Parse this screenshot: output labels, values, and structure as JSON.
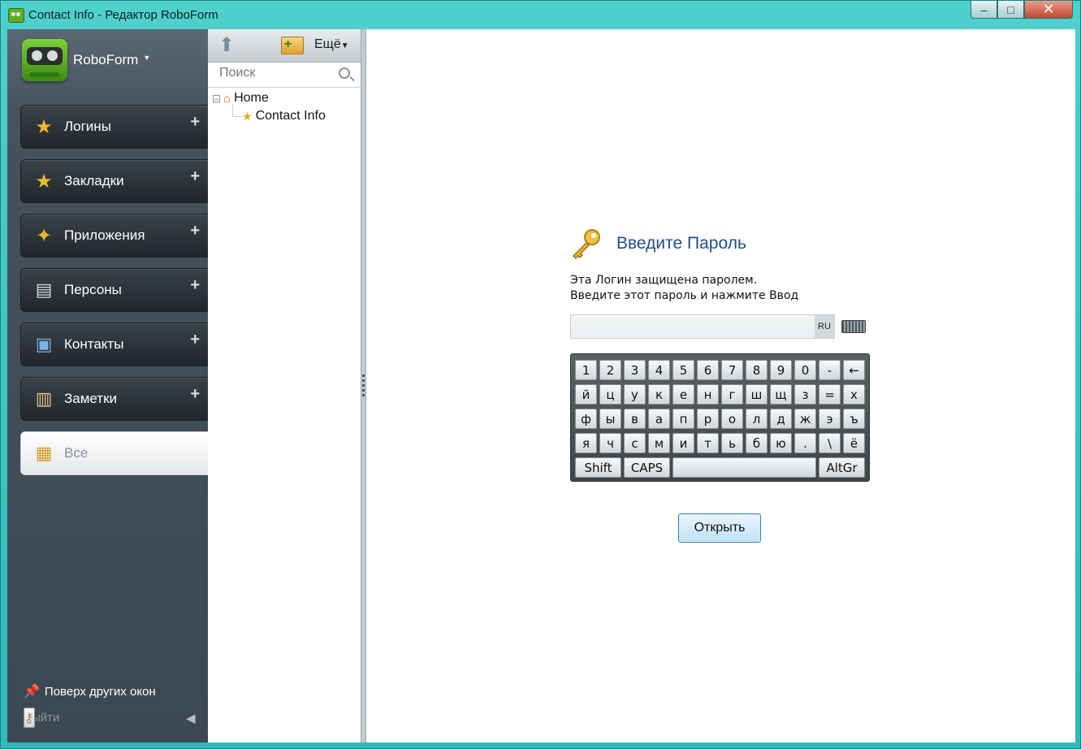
{
  "window": {
    "title": "Contact Info - Редактор RoboForm",
    "minimize": "–",
    "maximize": "□",
    "close": "✕"
  },
  "sidebar": {
    "brand": "RoboForm",
    "categories": [
      {
        "label": "Логины",
        "icon": "logins-icon",
        "plus": "+"
      },
      {
        "label": "Закладки",
        "icon": "bookmarks-icon",
        "plus": "+"
      },
      {
        "label": "Приложения",
        "icon": "applications-icon",
        "plus": "+"
      },
      {
        "label": "Персоны",
        "icon": "identities-icon",
        "plus": "+"
      },
      {
        "label": "Контакты",
        "icon": "contacts-icon",
        "plus": "+"
      },
      {
        "label": "Заметки",
        "icon": "notes-icon",
        "plus": "+"
      },
      {
        "label": "Все",
        "icon": "all-icon",
        "active": true
      }
    ],
    "always_on_top": "Поверх других окон",
    "logout": "Выйти"
  },
  "tree_panel": {
    "more_label": "Ещё",
    "search_placeholder": "Поиск",
    "tree": {
      "root": "Home",
      "child": "Contact Info"
    }
  },
  "dialog": {
    "title": "Введите Пароль",
    "message_line1": "Эта Логин защищена паролем.",
    "message_line2": "Введите этот пароль и нажмите Ввод",
    "password_value": "",
    "language": "RU",
    "keyboard": {
      "rows": [
        [
          "1",
          "2",
          "3",
          "4",
          "5",
          "6",
          "7",
          "8",
          "9",
          "0",
          "-",
          "←"
        ],
        [
          "й",
          "ц",
          "у",
          "к",
          "е",
          "н",
          "г",
          "ш",
          "щ",
          "з",
          "=",
          "х"
        ],
        [
          "ф",
          "ы",
          "в",
          "а",
          "п",
          "р",
          "о",
          "л",
          "д",
          "ж",
          "э",
          "ъ"
        ],
        [
          "я",
          "ч",
          "с",
          "м",
          "и",
          "т",
          "ь",
          "б",
          "ю",
          ".",
          "\\",
          "ё"
        ]
      ],
      "shift": "Shift",
      "caps": "CAPS",
      "space": "",
      "altgr": "AltGr"
    },
    "open_button": "Открыть"
  },
  "colors": {
    "title_accent": "#1f4c8c",
    "window_frame": "#3fc6c4",
    "sidebar_bg": "#46525c"
  }
}
